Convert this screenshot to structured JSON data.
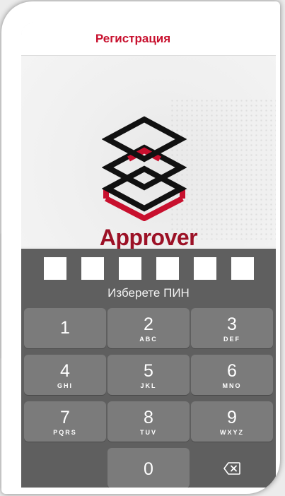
{
  "header": {
    "title": "Регистрация"
  },
  "app": {
    "name": "Approver",
    "logo_icon": "layered-diamonds-logo",
    "brand_color": "#c8102e"
  },
  "pin": {
    "length": 6,
    "label": "Изберете ПИН"
  },
  "keypad": {
    "keys": [
      {
        "digit": "1",
        "letters": ""
      },
      {
        "digit": "2",
        "letters": "ABC"
      },
      {
        "digit": "3",
        "letters": "DEF"
      },
      {
        "digit": "4",
        "letters": "GHI"
      },
      {
        "digit": "5",
        "letters": "JKL"
      },
      {
        "digit": "6",
        "letters": "MNO"
      },
      {
        "digit": "7",
        "letters": "PQRS"
      },
      {
        "digit": "8",
        "letters": "TUV"
      },
      {
        "digit": "9",
        "letters": "WXYZ"
      }
    ],
    "zero": {
      "digit": "0"
    },
    "delete_icon": "backspace-icon"
  }
}
